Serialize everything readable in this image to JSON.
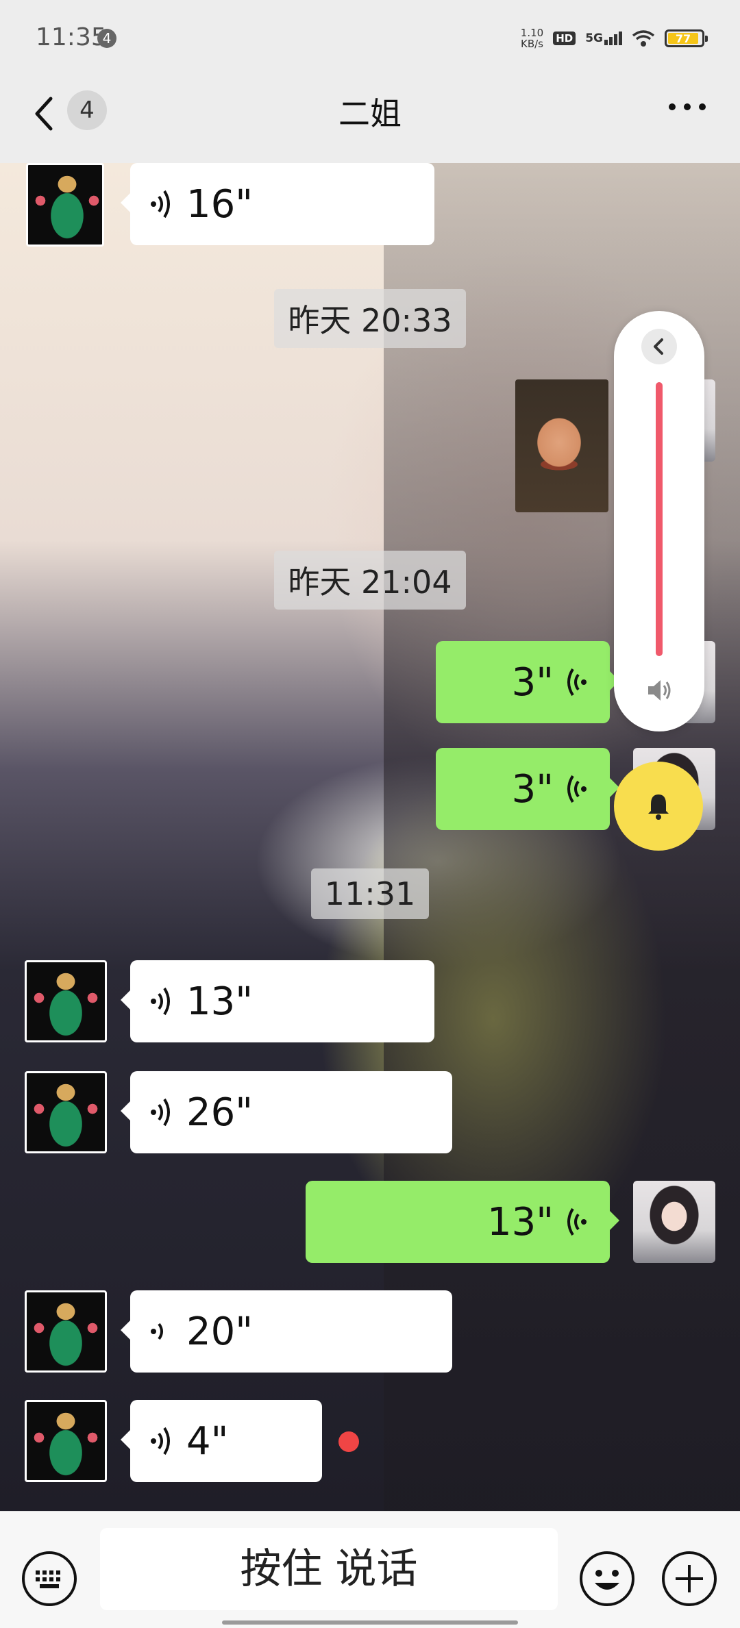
{
  "status_bar": {
    "time": "11:35",
    "notification_count": "4",
    "net_speed_value": "1.10",
    "net_speed_unit": "KB/s",
    "hd": "HD",
    "network": "5G",
    "battery": "77"
  },
  "header": {
    "unread_count": "4",
    "title": "二姐"
  },
  "messages": [
    {
      "side": "in",
      "duration": "16\""
    },
    {
      "timestamp": "昨天 20:33"
    },
    {
      "side": "out",
      "type": "sticker"
    },
    {
      "timestamp": "昨天 21:04"
    },
    {
      "side": "out",
      "duration": "3\""
    },
    {
      "side": "out",
      "duration": "3\""
    },
    {
      "timestamp": "11:31"
    },
    {
      "side": "in",
      "duration": "13\""
    },
    {
      "side": "in",
      "duration": "26\""
    },
    {
      "side": "out",
      "duration": "13\""
    },
    {
      "side": "in",
      "duration": "20\""
    },
    {
      "side": "in",
      "duration": "4\"",
      "unread": true
    }
  ],
  "volume_panel": {
    "level": 1.0,
    "accent_color": "#f0596b"
  },
  "input_bar": {
    "hold_to_talk": "按住 说话"
  },
  "colors": {
    "outgoing_bubble": "#95ec69",
    "incoming_bubble": "#ffffff",
    "bell": "#f8dd4e",
    "unread_dot": "#f04545"
  }
}
